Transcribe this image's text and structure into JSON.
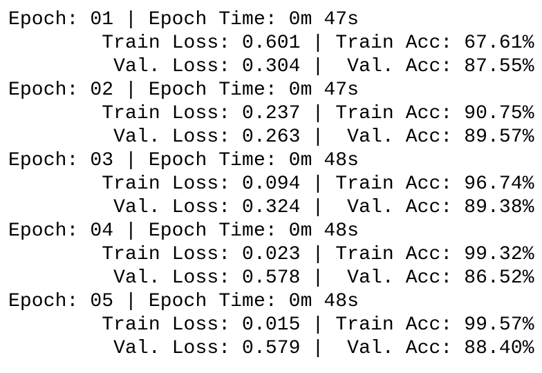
{
  "console": {
    "lines": [
      "Epoch: 01 | Epoch Time: 0m 47s",
      "        Train Loss: 0.601 | Train Acc: 67.61%",
      "         Val. Loss: 0.304 |  Val. Acc: 87.55%",
      "Epoch: 02 | Epoch Time: 0m 47s",
      "        Train Loss: 0.237 | Train Acc: 90.75%",
      "         Val. Loss: 0.263 |  Val. Acc: 89.57%",
      "Epoch: 03 | Epoch Time: 0m 48s",
      "        Train Loss: 0.094 | Train Acc: 96.74%",
      "         Val. Loss: 0.324 |  Val. Acc: 89.38%",
      "Epoch: 04 | Epoch Time: 0m 48s",
      "        Train Loss: 0.023 | Train Acc: 99.32%",
      "         Val. Loss: 0.578 |  Val. Acc: 86.52%",
      "Epoch: 05 | Epoch Time: 0m 48s",
      "        Train Loss: 0.015 | Train Acc: 99.57%",
      "         Val. Loss: 0.579 |  Val. Acc: 88.40%"
    ]
  }
}
